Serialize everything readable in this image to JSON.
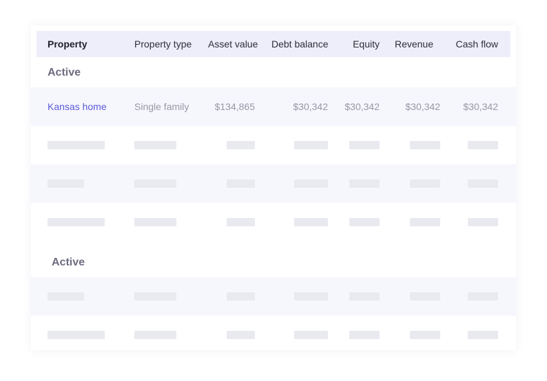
{
  "table": {
    "columns": [
      "Property",
      "Property type",
      "Asset value",
      "Debt balance",
      "Equity",
      "Revenue",
      "Cash flow"
    ],
    "sections": [
      {
        "label": "Active",
        "rows": [
          [
            "Kansas home",
            "Single family",
            "$134,865",
            "$30,342",
            "$30,342",
            "$30,342",
            "$30,342"
          ]
        ]
      },
      {
        "label": "Active"
      }
    ]
  }
}
